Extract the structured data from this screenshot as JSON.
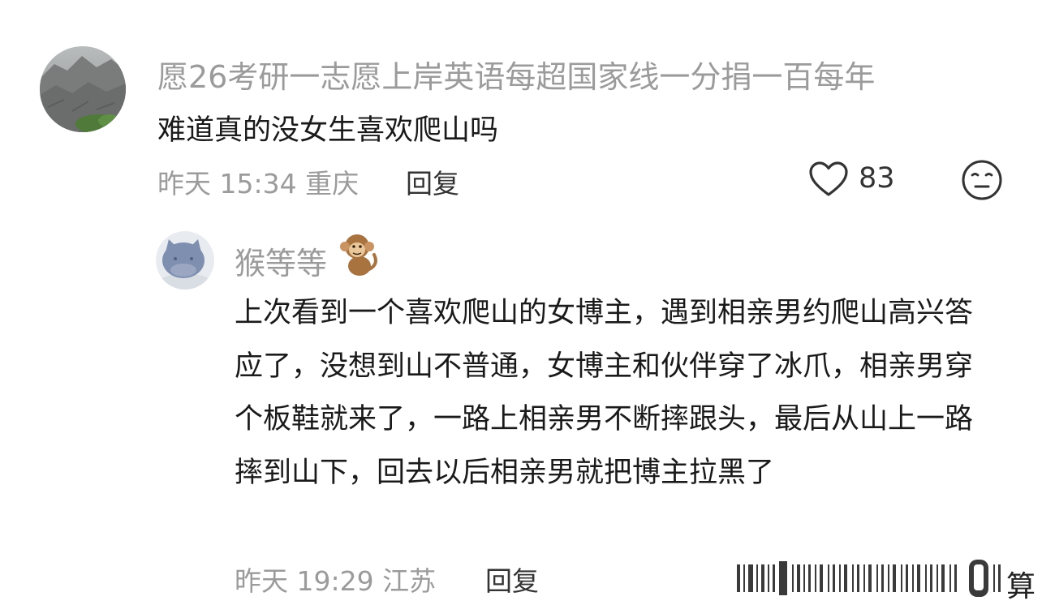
{
  "main_comment": {
    "username": "愿26考研一志愿上岸英语每超国家线一分捐一百每年",
    "text": "难道真的没女生喜欢爬山吗",
    "meta": "昨天 15:34 重庆",
    "reply_label": "回复",
    "like_count": "83",
    "like_icon": "heart-outline-icon",
    "extra_icon": "neutral-face-icon"
  },
  "reply_comment": {
    "username": "猴等等",
    "name_emoji": "monkey-emoji",
    "text": "上次看到一个喜欢爬山的女博主，遇到相亲男约爬山高兴答应了，没想到山不普通，女博主和伙伴穿了冰爪，相亲男穿个板鞋就来了，一路上相亲男不断摔跟头，最后从山上一路摔到山下，回去以后相亲男就把博主拉黑了",
    "meta": "昨天 19:29 江苏",
    "reply_label": "回复"
  },
  "watermark": {
    "char": "算"
  },
  "colors": {
    "secondary_text": "#9b9b9b",
    "primary_text": "#1a1a1a",
    "action_text": "#333333"
  }
}
